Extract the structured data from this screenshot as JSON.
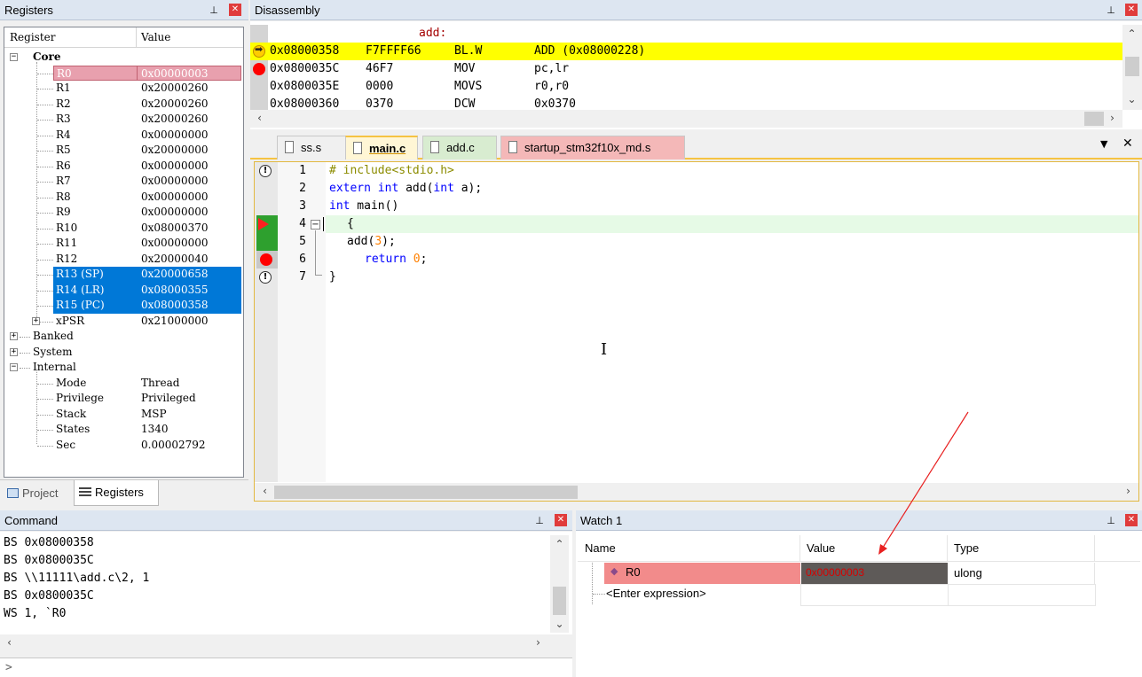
{
  "registers": {
    "title": "Registers",
    "col_register": "Register",
    "col_value": "Value",
    "core_label": "Core",
    "core_regs": [
      {
        "name": "R0",
        "value": "0x00000003"
      },
      {
        "name": "R1",
        "value": "0x20000260"
      },
      {
        "name": "R2",
        "value": "0x20000260"
      },
      {
        "name": "R3",
        "value": "0x20000260"
      },
      {
        "name": "R4",
        "value": "0x00000000"
      },
      {
        "name": "R5",
        "value": "0x20000000"
      },
      {
        "name": "R6",
        "value": "0x00000000"
      },
      {
        "name": "R7",
        "value": "0x00000000"
      },
      {
        "name": "R8",
        "value": "0x00000000"
      },
      {
        "name": "R9",
        "value": "0x00000000"
      },
      {
        "name": "R10",
        "value": "0x08000370"
      },
      {
        "name": "R11",
        "value": "0x00000000"
      },
      {
        "name": "R12",
        "value": "0x20000040"
      },
      {
        "name": "R13 (SP)",
        "value": "0x20000658"
      },
      {
        "name": "R14 (LR)",
        "value": "0x08000355"
      },
      {
        "name": "R15 (PC)",
        "value": "0x08000358"
      },
      {
        "name": "xPSR",
        "value": "0x21000000"
      }
    ],
    "groups": [
      "Banked",
      "System",
      "Internal"
    ],
    "internal": [
      {
        "name": "Mode",
        "value": "Thread"
      },
      {
        "name": "Privilege",
        "value": "Privileged"
      },
      {
        "name": "Stack",
        "value": "MSP"
      },
      {
        "name": "States",
        "value": "1340"
      },
      {
        "name": "Sec",
        "value": "0.00002792"
      }
    ],
    "tab_project": "Project",
    "tab_registers": "Registers"
  },
  "disassembly": {
    "title": "Disassembly",
    "label": "add:",
    "lines": [
      {
        "addr": "0x08000358",
        "code": "F7FFFF66",
        "mnem": "BL.W",
        "ops": "ADD (0x08000228)"
      },
      {
        "addr": "0x0800035C",
        "code": "46F7",
        "mnem": "MOV",
        "ops": "pc,lr"
      },
      {
        "addr": "0x0800035E",
        "code": "0000",
        "mnem": "MOVS",
        "ops": "r0,r0"
      },
      {
        "addr": "0x08000360",
        "code": "0370",
        "mnem": "DCW",
        "ops": "0x0370"
      }
    ]
  },
  "editor": {
    "tabs": [
      "ss.s",
      "main.c",
      "add.c",
      "startup_stm32f10x_md.s"
    ],
    "lines": [
      {
        "n": "1",
        "code": "# include<stdio.h>"
      },
      {
        "n": "2",
        "code": "extern int add(int a);"
      },
      {
        "n": "3",
        "code": "int main()"
      },
      {
        "n": "4",
        "code": "{"
      },
      {
        "n": "5",
        "code": "add(3);"
      },
      {
        "n": "6",
        "code": "return 0;"
      },
      {
        "n": "7",
        "code": "}"
      }
    ]
  },
  "command": {
    "title": "Command",
    "lines": [
      "BS 0x08000358",
      "BS 0x0800035C",
      "BS \\\\11111\\add.c\\2, 1",
      "BS 0x0800035C",
      "WS 1, `R0"
    ],
    "prompt": ">"
  },
  "watch": {
    "title": "Watch 1",
    "col_name": "Name",
    "col_value": "Value",
    "col_type": "Type",
    "rows": [
      {
        "name": "R0",
        "value": "0x00000003",
        "type": "ulong"
      }
    ],
    "enter_expression": "<Enter expression>"
  },
  "colors": {
    "exec_line": "#ffff00",
    "selection": "#0078d7",
    "watch_highlight": "#f28b8b",
    "breakpoint": "#ff0000",
    "current_line": "#e6fae6"
  }
}
